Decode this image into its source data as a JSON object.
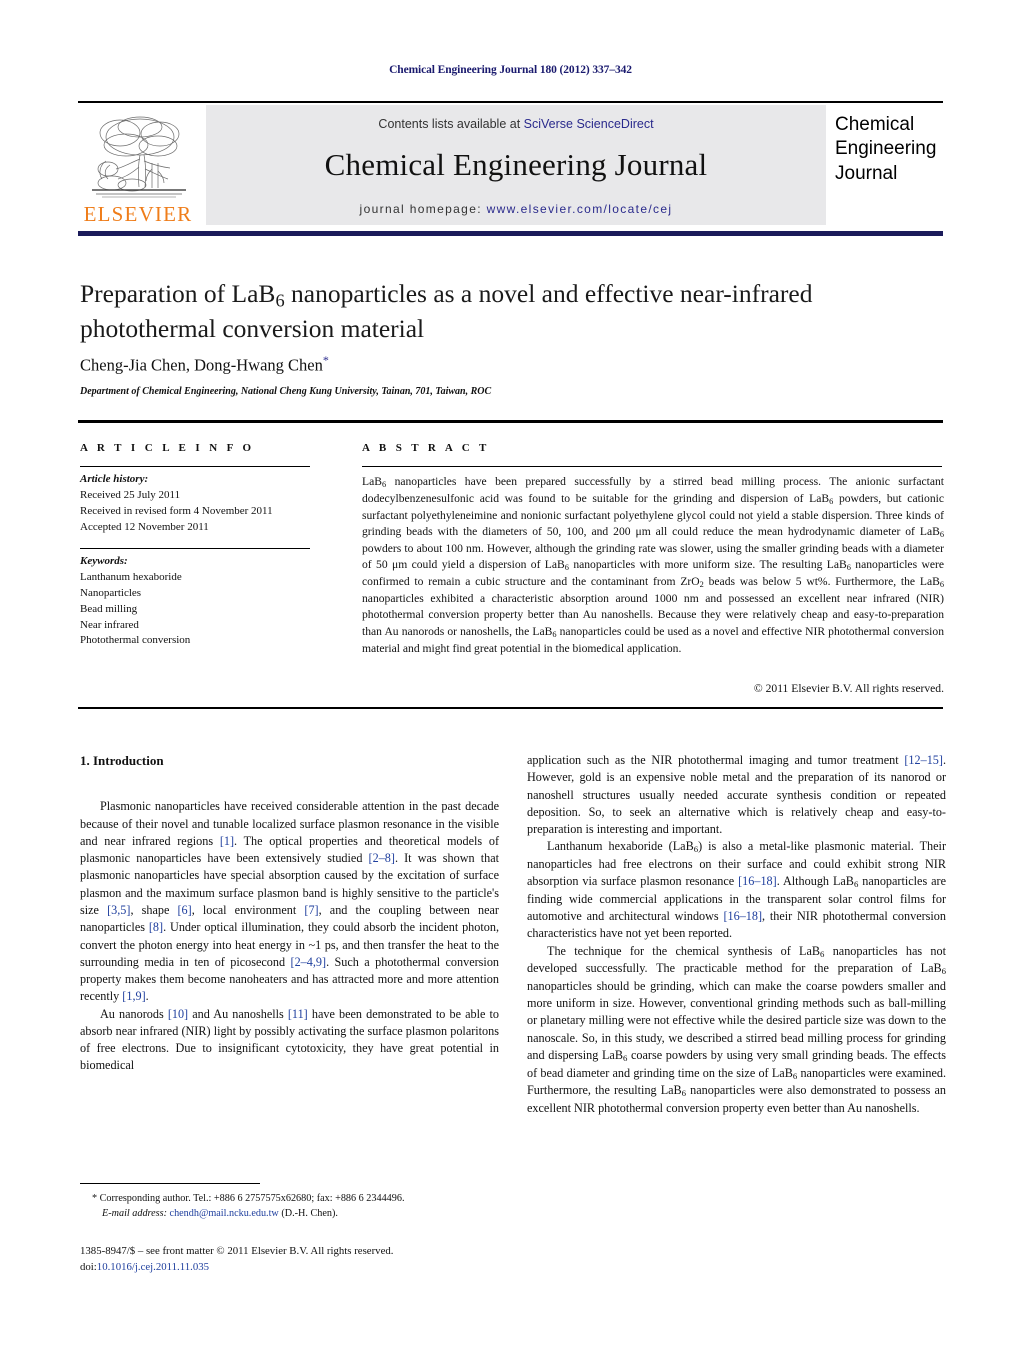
{
  "running_head": "Chemical Engineering Journal 180 (2012) 337–342",
  "masthead": {
    "contents_prefix": "Contents lists available at ",
    "contents_link": "SciVerse ScienceDirect",
    "journal_title": "Chemical Engineering Journal",
    "homepage_prefix": "journal homepage: ",
    "homepage_url": "www.elsevier.com/locate/cej",
    "publisher_wordmark": "ELSEVIER",
    "publisher_color": "#ef7d1a",
    "link_color": "#2a2a8c",
    "cover_title_line1": "Chemical",
    "cover_title_line2": "Engineering",
    "cover_title_line3": "Journal"
  },
  "article": {
    "title_part1": "Preparation of LaB",
    "title_sub": "6",
    "title_part2": " nanoparticles as a novel and effective near-infrared photothermal conversion material",
    "authors": "Cheng-Jia Chen, Dong-Hwang Chen",
    "corresponding_marker": "*",
    "affiliation": "Department of Chemical Engineering, National Cheng Kung University, Tainan, 701, Taiwan, ROC"
  },
  "headers": {
    "article_info": "A R T I C L E   I N F O",
    "abstract": "A B S T R A C T"
  },
  "article_info": {
    "history_label": "Article history:",
    "history": [
      "Received 25 July 2011",
      "Received in revised form 4 November 2011",
      "Accepted 12 November 2011"
    ],
    "keywords_label": "Keywords:",
    "keywords": [
      "Lanthanum hexaboride",
      "Nanoparticles",
      "Bead milling",
      "Near infrared",
      "Photothermal conversion"
    ]
  },
  "abstract": {
    "text_a": "LaB",
    "sub_a": "6",
    "text_b": " nanoparticles have been prepared successfully by a stirred bead milling process. The anionic surfactant dodecylbenzenesulfonic acid was found to be suitable for the grinding and dispersion of LaB",
    "sub_b": "6",
    "text_c": " powders, but cationic surfactant polyethyleneimine and nonionic surfactant polyethylene glycol could not yield a stable dispersion. Three kinds of grinding beads with the diameters of 50, 100, and 200 μm all could reduce the mean hydrodynamic diameter of LaB",
    "sub_c": "6",
    "text_d": " powders to about 100 nm. However, although the grinding rate was slower, using the smaller grinding beads with a diameter of 50 μm could yield a dispersion of LaB",
    "sub_d": "6",
    "text_e": " nanoparticles with more uniform size. The resulting LaB",
    "sub_e": "6",
    "text_f": " nanoparticles were confirmed to remain a cubic structure and the contaminant from ZrO",
    "sub_f": "2",
    "text_g": " beads was below 5 wt%. Furthermore, the LaB",
    "sub_g": "6",
    "text_h": " nanoparticles exhibited a characteristic absorption around 1000 nm and possessed an excellent near infrared (NIR) photothermal conversion property better than Au nanoshells. Because they were relatively cheap and easy-to-preparation than Au nanorods or nanoshells, the LaB",
    "sub_h": "6",
    "text_i": " nanoparticles could be used as a novel and effective NIR photothermal conversion material and might find great potential in the biomedical application.",
    "copyright": "© 2011 Elsevier B.V. All rights reserved."
  },
  "body": {
    "section_number_title": "1.  Introduction",
    "left": {
      "p1_a": "Plasmonic nanoparticles have received considerable attention in the past decade because of their novel and tunable localized surface plasmon resonance in the visible and near infrared regions ",
      "c1": "[1]",
      "p1_b": ". The optical properties and theoretical models of plasmonic nanoparticles have been extensively studied ",
      "c2": "[2–8]",
      "p1_c": ". It was shown that plasmonic nanoparticles have special absorption caused by the excitation of surface plasmon and the maximum surface plasmon band is highly sensitive to the particle's size ",
      "c3": "[3,5]",
      "p1_d": ", shape ",
      "c4": "[6]",
      "p1_e": ", local environment ",
      "c5": "[7]",
      "p1_f": ", and the coupling between near nanoparticles ",
      "c6": "[8]",
      "p1_g": ". Under optical illumination, they could absorb the incident photon, convert the photon energy into heat energy in ~1 ps, and then transfer the heat to the surrounding media in ten of picosecond ",
      "c7": "[2–4,9]",
      "p1_h": ". Such a photothermal conversion property makes them become nanoheaters and has attracted more and more attention recently ",
      "c8": "[1,9]",
      "p1_i": ".",
      "p2_a": "Au nanorods ",
      "c9": "[10]",
      "p2_b": " and Au nanoshells ",
      "c10": "[11]",
      "p2_c": " have been demonstrated to be able to absorb near infrared (NIR) light by possibly activating the surface plasmon polaritons of free electrons. Due to insignificant cytotoxicity, they have great potential in biomedical"
    },
    "right": {
      "p1_a": "application such as the NIR photothermal imaging and tumor treatment ",
      "c11": "[12–15]",
      "p1_b": ". However, gold is an expensive noble metal and the preparation of its nanorod or nanoshell structures usually needed accurate synthesis condition or repeated deposition. So, to seek an alternative which is relatively cheap and easy-to-preparation is interesting and important.",
      "p2_a": "Lanthanum hexaboride (LaB",
      "sub_a": "6",
      "p2_b": ") is also a metal-like plasmonic material. Their nanoparticles had free electrons on their surface and could exhibit strong NIR absorption via surface plasmon resonance ",
      "c12": "[16–18]",
      "p2_c": ". Although LaB",
      "sub_b": "6",
      "p2_d": " nanoparticles are finding wide commercial applications in the transparent solar control films for automotive and architectural windows ",
      "c13": "[16–18]",
      "p2_e": ", their NIR photothermal conversion characteristics have not yet been reported.",
      "p3_a": "The technique for the chemical synthesis of LaB",
      "sub_c": "6",
      "p3_b": " nanoparticles has not developed successfully. The practicable method for the preparation of LaB",
      "sub_d": "6",
      "p3_c": " nanoparticles should be grinding, which can make the coarse powders smaller and more uniform in size. However, conventional grinding methods such as ball-milling or planetary milling were not effective while the desired particle size was down to the nanoscale. So, in this study, we described a stirred bead milling process for grinding and dispersing LaB",
      "sub_e": "6",
      "p3_d": " coarse powders by using very small grinding beads. The effects of bead diameter and grinding time on the size of LaB",
      "sub_f": "6",
      "p3_e": " nanoparticles were examined. Furthermore, the resulting LaB",
      "sub_g": "6",
      "p3_f": " nanoparticles were also demonstrated to possess an excellent NIR photothermal conversion property even better than Au nanoshells."
    }
  },
  "footer": {
    "corresponding": "* Corresponding author. Tel.: +886 6 2757575x62680; fax: +886 6 2344496.",
    "email_label": "E-mail address:",
    "email": "chendh@mail.ncku.edu.tw",
    "email_suffix": " (D.-H. Chen).",
    "imprint_line": "1385-8947/$ – see front matter © 2011 Elsevier B.V. All rights reserved.",
    "doi_label": "doi:",
    "doi": "10.1016/j.cej.2011.11.035"
  }
}
